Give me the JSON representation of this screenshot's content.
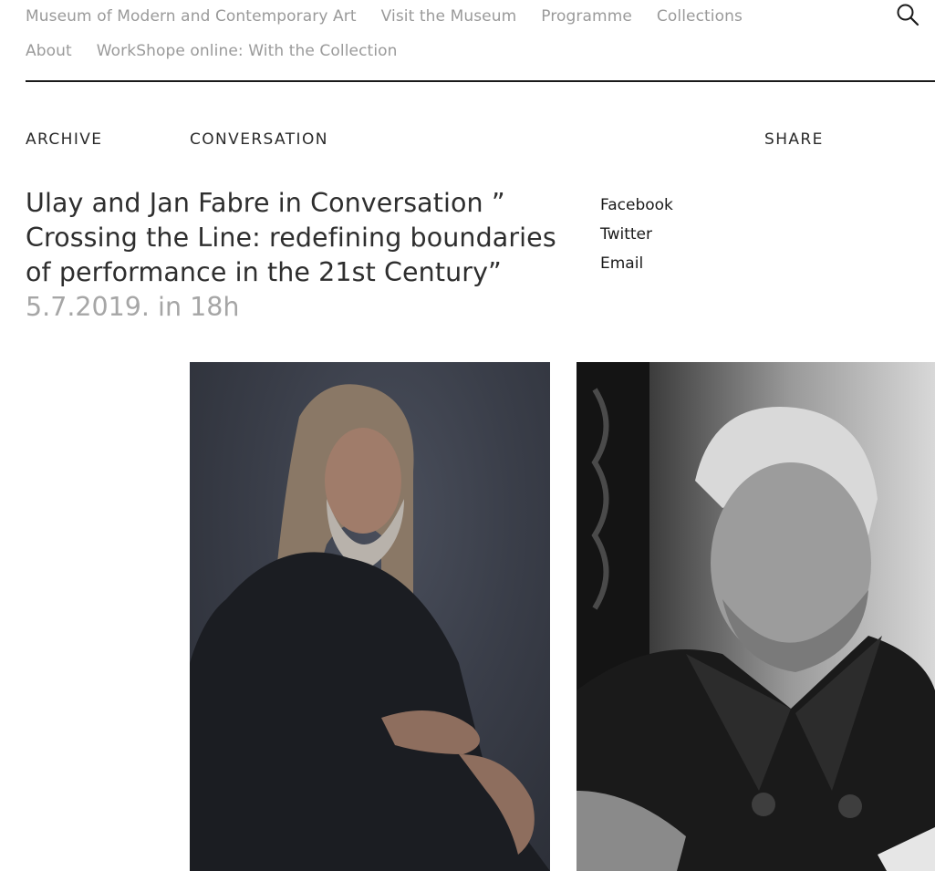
{
  "nav": {
    "row1": [
      {
        "label": "Museum of Modern and Contemporary Art",
        "name": "nav-link-museum"
      },
      {
        "label": "Visit the Museum",
        "name": "nav-link-visit"
      },
      {
        "label": "Programme",
        "name": "nav-link-programme"
      },
      {
        "label": "Collections",
        "name": "nav-link-collections"
      }
    ],
    "row2": [
      {
        "label": "About",
        "name": "nav-link-about"
      },
      {
        "label": "WorkShope online: With the Collection",
        "name": "nav-link-workshop"
      }
    ],
    "search_icon": "search-icon"
  },
  "meta": {
    "archive": "ARCHIVE",
    "category": "CONVERSATION",
    "share": "SHARE"
  },
  "event": {
    "title": "Ulay and Jan Fabre in Conversation ” Crossing the Line: redefining boundaries of performance in the 21st Century”",
    "date": "5.7.2019. in 18h"
  },
  "share_links": [
    {
      "label": "Facebook",
      "name": "share-facebook-link"
    },
    {
      "label": "Twitter",
      "name": "share-twitter-link"
    },
    {
      "label": "Email",
      "name": "share-email-link"
    }
  ],
  "colors": {
    "nav_text": "#9a9a9a",
    "body_text": "#2e2e2e",
    "date_text": "#a6a6a6",
    "divider": "#1a1a1a"
  }
}
